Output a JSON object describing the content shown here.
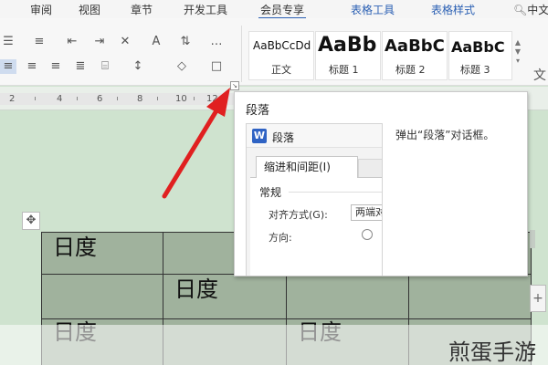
{
  "menu": {
    "items": [
      "审阅",
      "视图",
      "章节",
      "开发工具",
      "会员专享"
    ],
    "context_tabs": [
      "表格工具",
      "表格样式"
    ],
    "search": "中文"
  },
  "ribbon": {
    "styles": [
      {
        "sample": "AaBbCcDd",
        "label": "正文"
      },
      {
        "sample": "AaBb",
        "label": "标题 1"
      },
      {
        "sample": "AaBbC",
        "label": "标题 2"
      },
      {
        "sample": "AaBbC",
        "label": "标题 3"
      }
    ],
    "right_label": "文"
  },
  "ruler": {
    "numbers": [
      "2",
      "4",
      "6",
      "8",
      "10",
      "12"
    ]
  },
  "tooltip": {
    "title": "段落",
    "description": "弹出“段落”对话框。",
    "dialog": {
      "title": "段落",
      "logo": "W",
      "tab": "缩进和间距(I)",
      "section": "常规",
      "align_label": "对齐方式(G):",
      "align_value": "两端对齐",
      "direction_label": "方向:"
    }
  },
  "table": {
    "cells": [
      "日度",
      "日度",
      "日度",
      "日度"
    ]
  },
  "watermark": "煎蛋手游",
  "colors": {
    "accent": "#2a5fb3",
    "arrow": "#e02020",
    "doc_bg": "#cfe3cf",
    "table_fill": "#a0b29d"
  }
}
